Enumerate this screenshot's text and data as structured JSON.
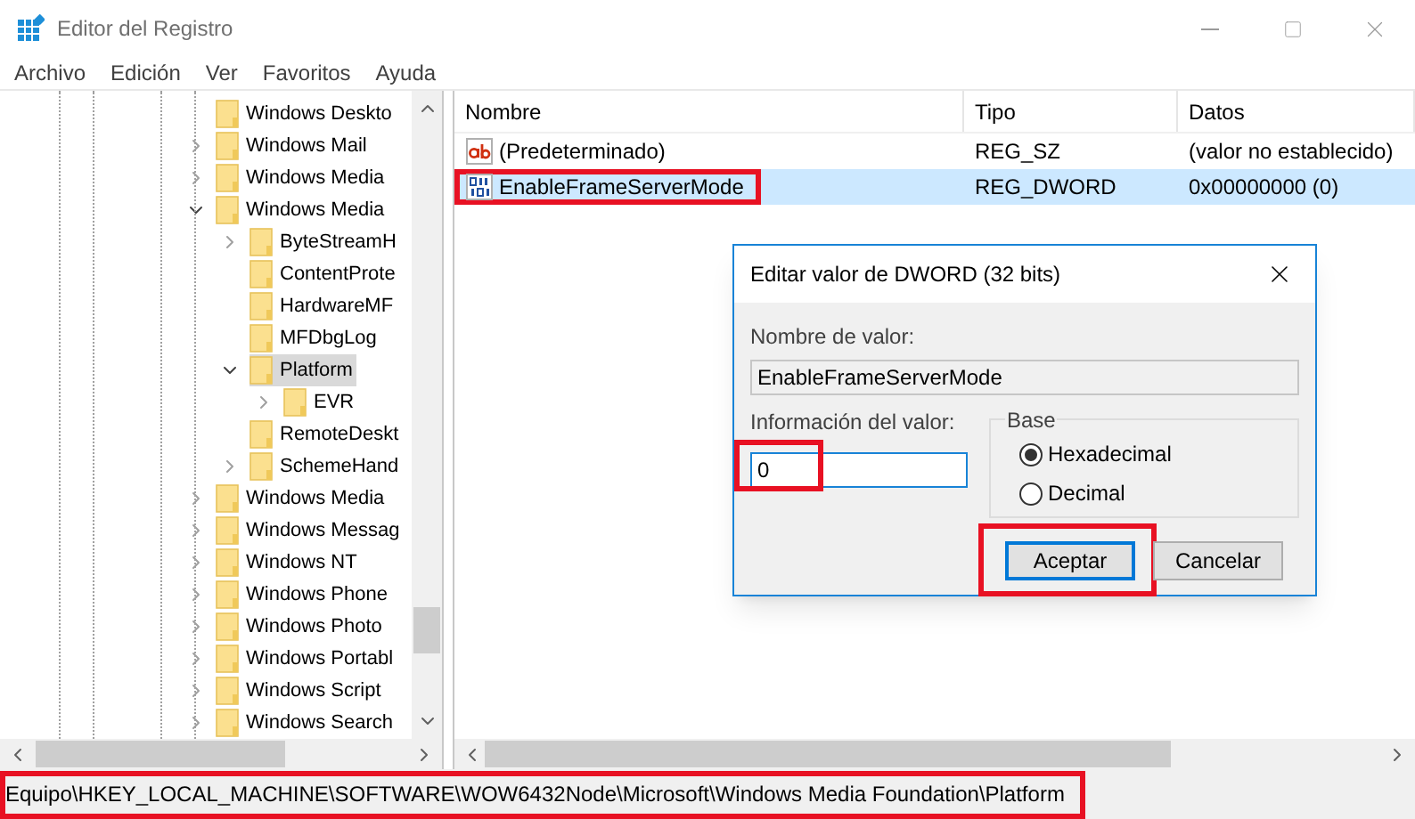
{
  "window": {
    "title": "Editor del Registro"
  },
  "menu": [
    "Archivo",
    "Edición",
    "Ver",
    "Favoritos",
    "Ayuda"
  ],
  "tree": [
    {
      "label": "Windows Deskto",
      "expandable": false,
      "selected": false
    },
    {
      "label": "Windows Mail",
      "expandable": true,
      "expanded": false,
      "selected": false
    },
    {
      "label": "Windows Media",
      "expandable": true,
      "expanded": false,
      "selected": false
    },
    {
      "label": "Windows Media",
      "expandable": true,
      "expanded": true,
      "selected": false,
      "children": [
        {
          "label": "ByteStreamH",
          "expandable": true,
          "expanded": false,
          "selected": false
        },
        {
          "label": "ContentProte",
          "expandable": false,
          "selected": false
        },
        {
          "label": "HardwareMF",
          "expandable": false,
          "selected": false
        },
        {
          "label": "MFDbgLog",
          "expandable": false,
          "selected": false
        },
        {
          "label": "Platform",
          "expandable": true,
          "expanded": true,
          "selected": true,
          "children": [
            {
              "label": "EVR",
              "expandable": true,
              "expanded": false,
              "selected": false
            }
          ]
        },
        {
          "label": "RemoteDeskt",
          "expandable": false,
          "selected": false
        },
        {
          "label": "SchemeHand",
          "expandable": true,
          "expanded": false,
          "selected": false
        }
      ]
    },
    {
      "label": "Windows Media",
      "expandable": true,
      "expanded": false,
      "selected": false
    },
    {
      "label": "Windows Messag",
      "expandable": true,
      "expanded": false,
      "selected": false
    },
    {
      "label": "Windows NT",
      "expandable": true,
      "expanded": false,
      "selected": false
    },
    {
      "label": "Windows Phone",
      "expandable": true,
      "expanded": false,
      "selected": false
    },
    {
      "label": "Windows Photo",
      "expandable": true,
      "expanded": false,
      "selected": false
    },
    {
      "label": "Windows Portabl",
      "expandable": true,
      "expanded": false,
      "selected": false
    },
    {
      "label": "Windows Script",
      "expandable": true,
      "expanded": false,
      "selected": false
    },
    {
      "label": "Windows Search",
      "expandable": true,
      "expanded": false,
      "selected": false
    }
  ],
  "values": {
    "columns": [
      "Nombre",
      "Tipo",
      "Datos"
    ],
    "rows": [
      {
        "kind": "string",
        "name": "(Predeterminado)",
        "type": "REG_SZ",
        "data": "(valor no establecido)",
        "selected": false,
        "highlighted": false
      },
      {
        "kind": "binary",
        "name": "EnableFrameServerMode",
        "type": "REG_DWORD",
        "data": "0x00000000 (0)",
        "selected": true,
        "highlighted": true
      }
    ]
  },
  "dialog": {
    "title": "Editar valor de DWORD (32 bits)",
    "name_label": "Nombre de valor:",
    "name_value": "EnableFrameServerMode",
    "data_label": "Información del valor:",
    "data_value": "0",
    "data_highlighted": true,
    "base_label": "Base",
    "bases": [
      {
        "label": "Hexadecimal",
        "selected": true
      },
      {
        "label": "Decimal",
        "selected": false
      }
    ],
    "buttons": [
      {
        "label": "Aceptar",
        "default": true,
        "highlighted": true
      },
      {
        "label": "Cancelar",
        "default": false,
        "highlighted": false
      }
    ]
  },
  "status_bar": {
    "path": "Equipo\\HKEY_LOCAL_MACHINE\\SOFTWARE\\WOW6432Node\\Microsoft\\Windows Media Foundation\\Platform",
    "highlighted": true
  }
}
